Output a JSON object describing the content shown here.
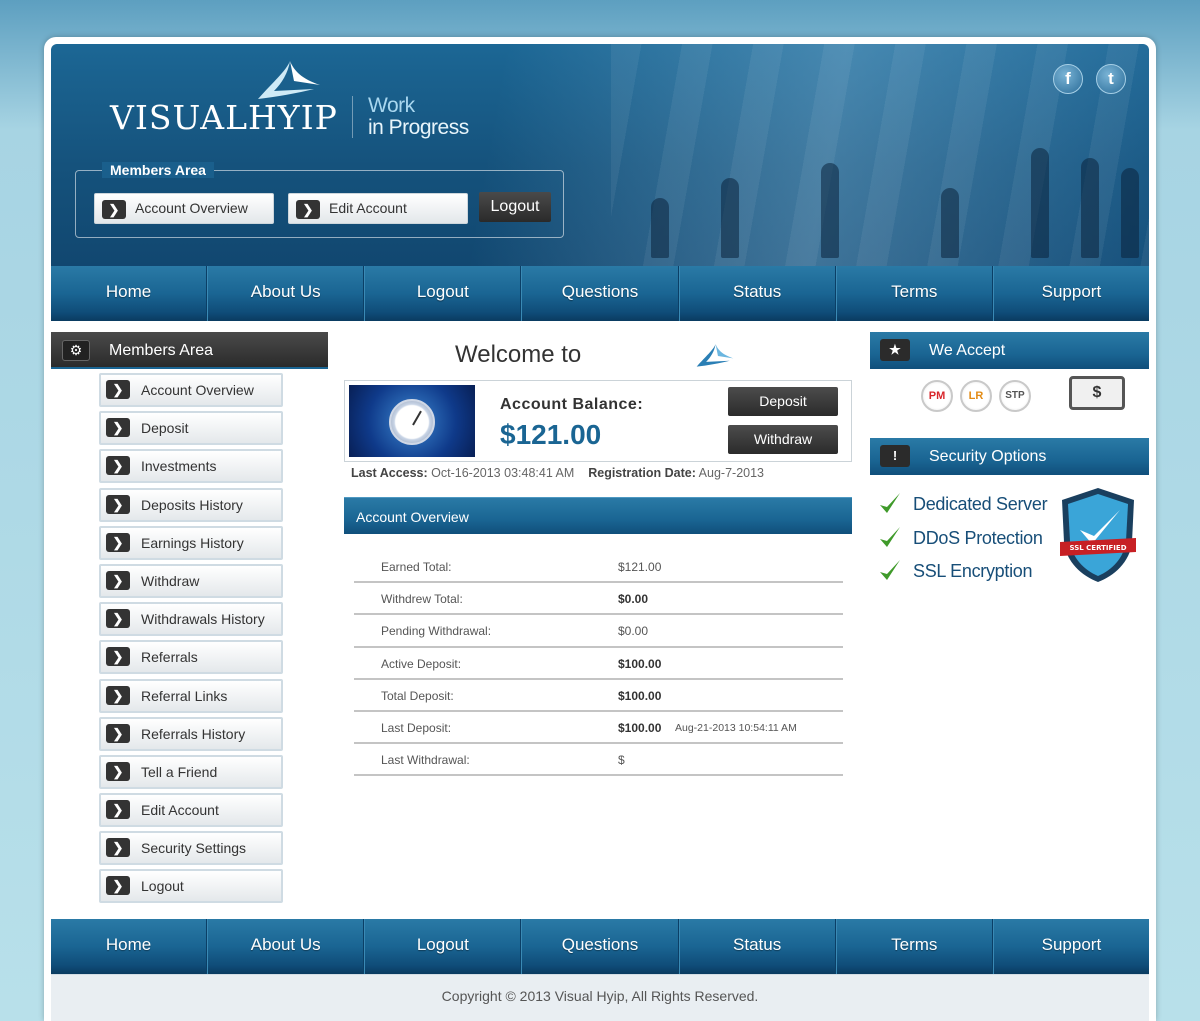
{
  "header": {
    "logo_text": "VISUALHYIP",
    "tagline_line1": "Work",
    "tagline_line2": "in Progress",
    "social": [
      {
        "icon": "facebook-icon",
        "glyph": "f"
      },
      {
        "icon": "twitter-icon",
        "glyph": "t"
      }
    ],
    "members_area": {
      "legend": "Members Area",
      "account_overview": "Account Overview",
      "edit_account": "Edit Account",
      "logout": "Logout"
    }
  },
  "nav": [
    "Home",
    "About Us",
    "Logout",
    "Questions",
    "Status",
    "Terms",
    "Support"
  ],
  "sidebar": {
    "title": "Members Area",
    "items": [
      "Account Overview",
      "Deposit",
      "Investments",
      "Deposits History",
      "Earnings History",
      "Withdraw",
      "Withdrawals History",
      "Referrals",
      "Referral Links",
      "Referrals History",
      "Tell a Friend",
      "Edit Account",
      "Security Settings",
      "Logout"
    ]
  },
  "main": {
    "welcome": "Welcome to",
    "balance_label": "Account Balance:",
    "balance_value": "$121.00",
    "deposit_button": "Deposit",
    "withdraw_button": "Withdraw",
    "last_access_label": "Last Access:",
    "last_access_value": "Oct-16-2013 03:48:41 AM",
    "registration_label": "Registration Date:",
    "registration_value": "Aug-7-2013",
    "overview_title": "Account Overview",
    "overview_rows": [
      {
        "label": "Earned Total:",
        "value": "$121.00",
        "bold": false,
        "date": ""
      },
      {
        "label": "Withdrew Total:",
        "value": "$0.00",
        "bold": true,
        "date": ""
      },
      {
        "label": "Pending Withdrawal:",
        "value": "$0.00",
        "bold": false,
        "date": ""
      },
      {
        "label": "Active Deposit:",
        "value": "$100.00",
        "bold": true,
        "date": ""
      },
      {
        "label": "Total Deposit:",
        "value": "$100.00",
        "bold": true,
        "date": ""
      },
      {
        "label": "Last Deposit:",
        "value": "$100.00",
        "bold": true,
        "date": "Aug-21-2013 10:54:11 AM"
      },
      {
        "label": "Last Withdrawal:",
        "value": "$",
        "bold": false,
        "date": ""
      }
    ]
  },
  "right": {
    "we_accept_title": "We Accept",
    "payment_icons": [
      "PM",
      "LR",
      "STP"
    ],
    "cash_symbol": "$",
    "security_title": "Security Options",
    "security_items": [
      "Dedicated Server",
      "DDoS Protection",
      "SSL Encryption"
    ],
    "ssl_badge_text": "SSL CERTIFIED"
  },
  "footer": {
    "copyright": "Copyright © 2013 Visual Hyip, All Rights Reserved."
  },
  "colors": {
    "primary": "#1a6593",
    "dark_button": "#2b2b2b",
    "check_green": "#3f9a2a"
  }
}
